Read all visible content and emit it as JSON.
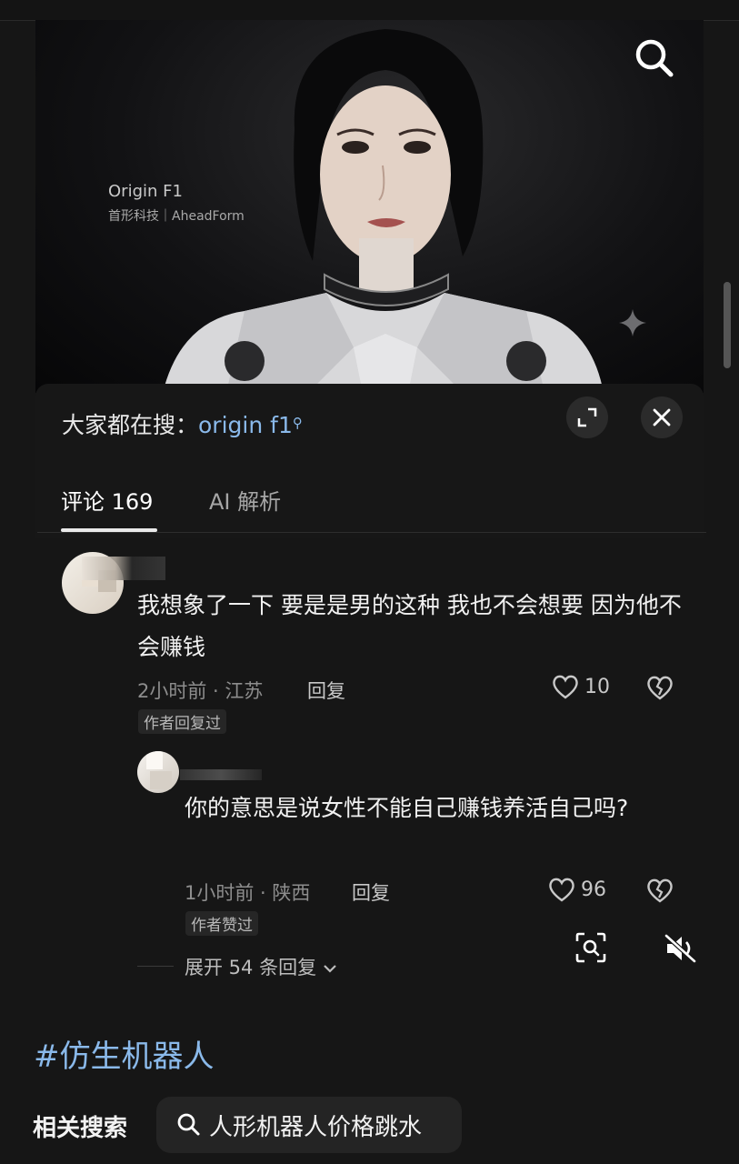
{
  "video": {
    "brand_title": "Origin F1",
    "brand_subtitle": "首形科技｜AheadForm"
  },
  "search_hint": {
    "prefix": "大家都在搜：",
    "keyword": "origin f1"
  },
  "tabs": [
    {
      "label": "评论 169"
    },
    {
      "label": "AI 解析"
    }
  ],
  "comments": [
    {
      "text": "我想象了一下 要是是男的这种 我也不会想要 因为他不会赚钱",
      "meta": "2小时前 · 江苏",
      "reply_label": "回复",
      "likes": "10",
      "badge": "作者回复过"
    },
    {
      "text": "你的意思是说女性不能自己赚钱养活自己吗?",
      "meta": "1小时前 · 陕西",
      "reply_label": "回复",
      "likes": "96",
      "badge": "作者赞过"
    }
  ],
  "expand_replies": "展开 54 条回复",
  "hashtag": "#仿生机器人",
  "related": {
    "label": "相关搜索",
    "query": "人形机器人价格跳水"
  },
  "colors": {
    "background": "#161616",
    "link_blue": "#8ab9ea"
  },
  "icons": [
    "search-icon",
    "expand-icon",
    "close-icon",
    "heart-icon",
    "broken-heart-icon",
    "scan-search-icon",
    "mute-icon",
    "chevron-down-icon",
    "sparkle-icon"
  ]
}
